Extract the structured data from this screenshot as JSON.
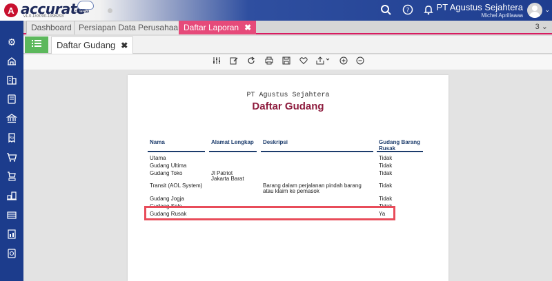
{
  "app": {
    "logo_letter": "A",
    "logo_text": "accurate",
    "logo_sub": "online",
    "version": "v1.0.1#3090-1998293",
    "company": "PT Agustus Sejahtera",
    "user": "Michel Aprillaaaa"
  },
  "header_icons": [
    "search-icon",
    "help-icon",
    "bell-icon"
  ],
  "tabs": [
    {
      "label": "Dashboard",
      "active": false
    },
    {
      "label": "Persiapan Data Perusahaan",
      "active": false
    },
    {
      "label": "Daftar Laporan",
      "active": true,
      "close": "✖"
    }
  ],
  "tab_count": "3",
  "subtab": {
    "label": "Daftar Gudang",
    "close": "✖"
  },
  "sidebar_icons": [
    "settings-icon",
    "company-icon",
    "building-icon",
    "ledger-icon",
    "bank-icon",
    "receipt-icon",
    "cart-icon",
    "purchase-icon",
    "inventory-icon",
    "warehouse-icon",
    "report-icon",
    "support-icon"
  ],
  "toolbar_icons": [
    "filter-icon",
    "edit-icon",
    "refresh-icon",
    "print-icon",
    "save-icon",
    "favorite-icon",
    "export-icon",
    "zoom-in-icon",
    "zoom-out-icon"
  ],
  "report": {
    "company": "PT Agustus Sejahtera",
    "title": "Daftar Gudang",
    "columns": [
      "Nama",
      "Alamat Lengkap",
      "Deskripsi",
      "Gudang Barang Rusak"
    ],
    "rows": [
      {
        "nama": "Utama",
        "alamat": "",
        "deskripsi": "",
        "rusak": "Tidak"
      },
      {
        "nama": "Gudang Ultima",
        "alamat": "",
        "deskripsi": "",
        "rusak": "Tidak"
      },
      {
        "nama": "Gudang Toko",
        "alamat": "Jl Patriot\nJakarta Barat",
        "deskripsi": "",
        "rusak": "Tidak"
      },
      {
        "nama": "Transit (AOL System)",
        "alamat": "",
        "deskripsi": "Barang dalam perjalanan pindah barang atau klaim ke pemasok",
        "rusak": "Tidak"
      },
      {
        "nama": "Gudang Jogja",
        "alamat": "",
        "deskripsi": "",
        "rusak": "Tidak"
      },
      {
        "nama": "Gudang Solo",
        "alamat": "",
        "deskripsi": "",
        "rusak": "Tidak"
      },
      {
        "nama": "Gudang Rusak",
        "alamat": "",
        "deskripsi": "",
        "rusak": "Ya"
      }
    ]
  },
  "colors": {
    "accent": "#e64a7a",
    "sidebar": "#1c3c8c",
    "highlight": "#e84c5a",
    "title": "#8e1c3e"
  }
}
